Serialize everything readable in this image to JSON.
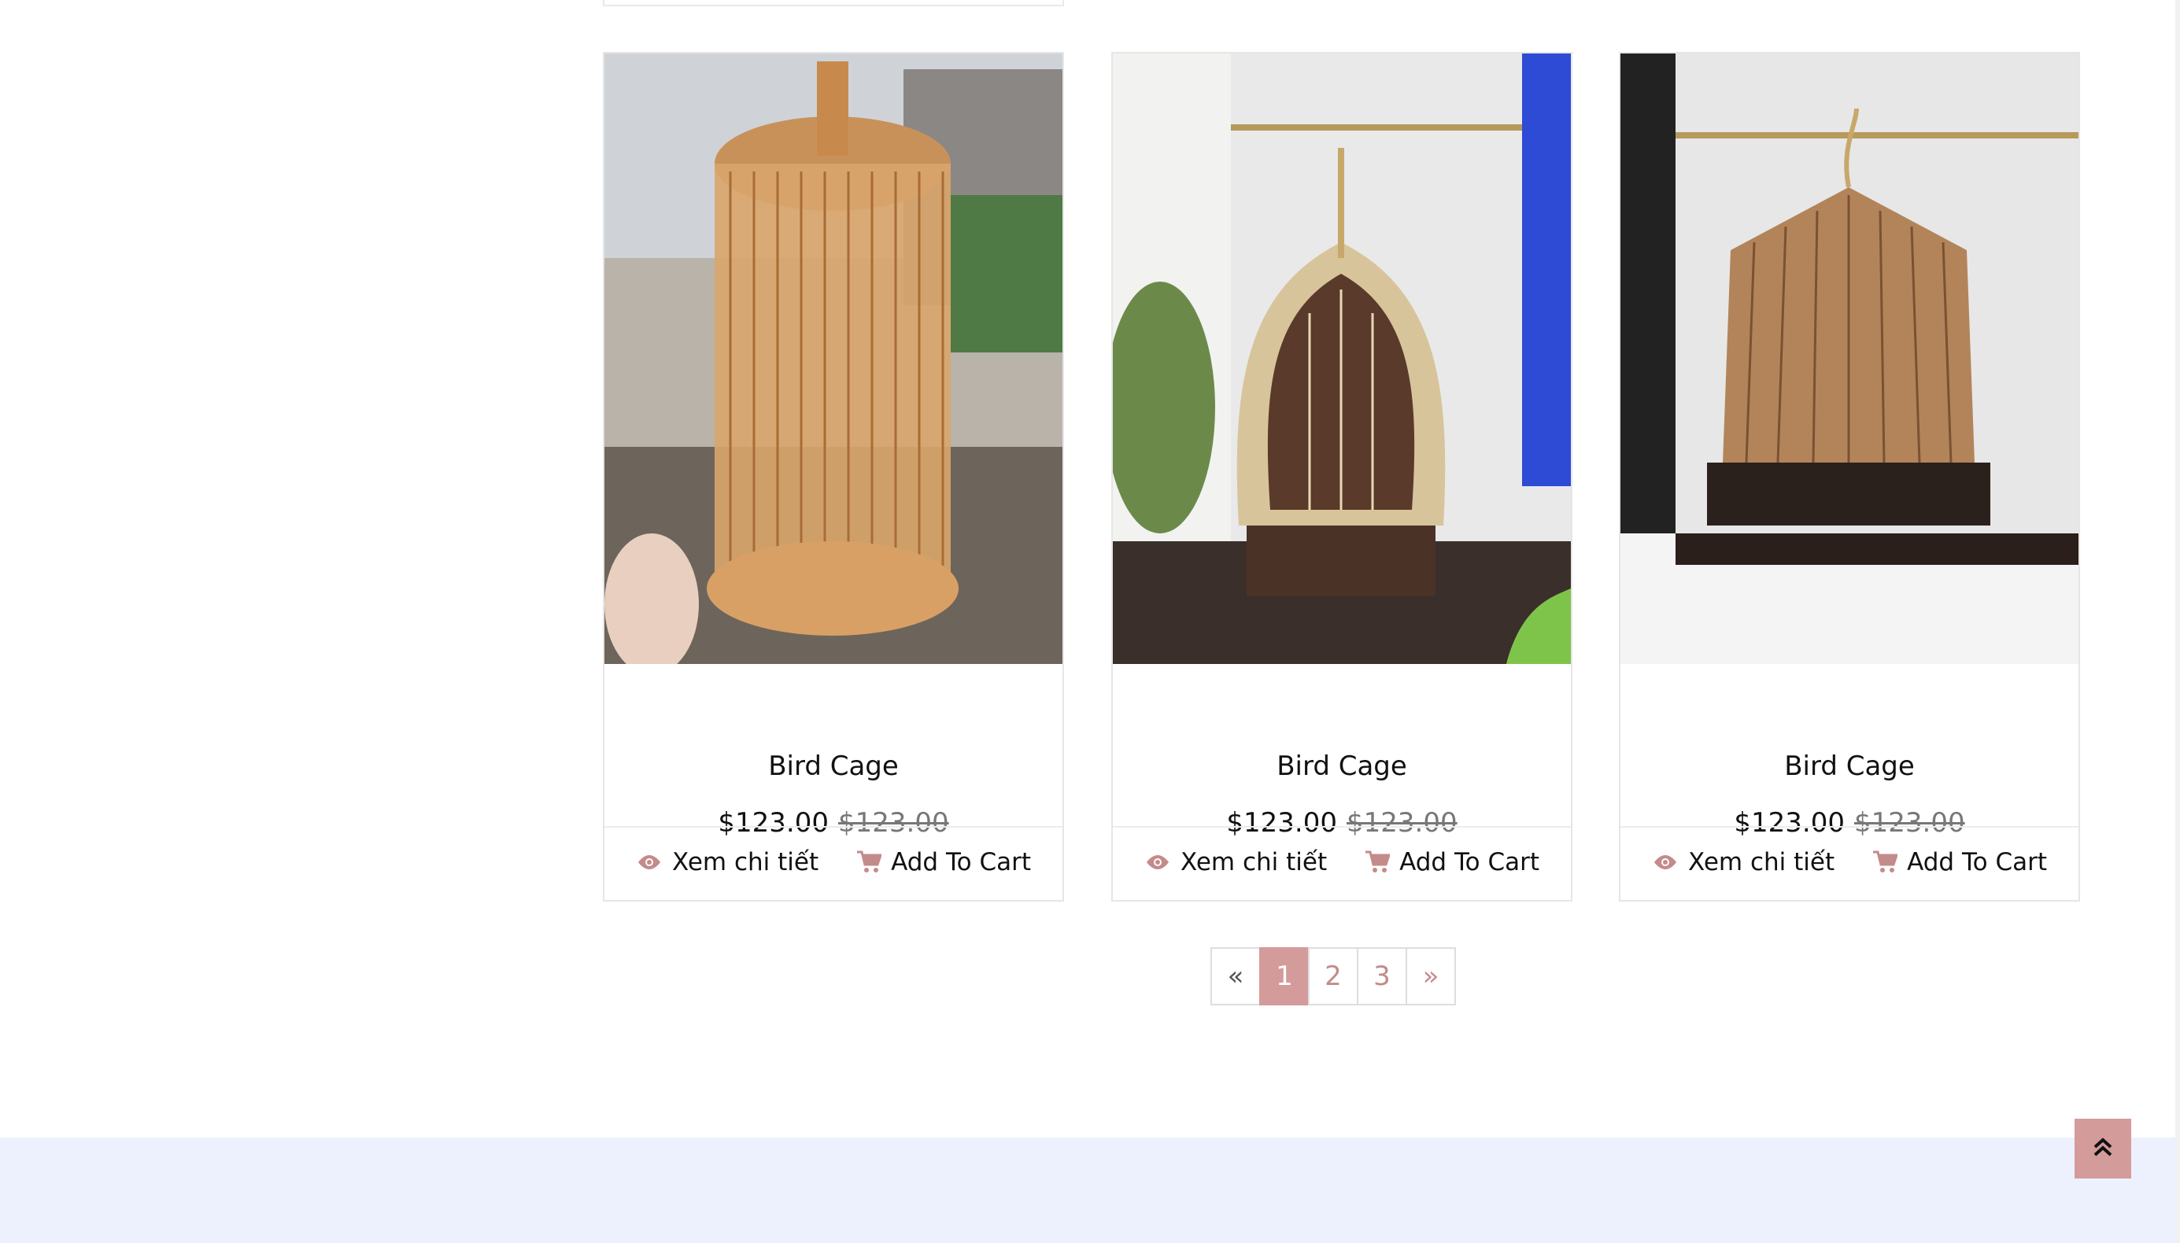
{
  "products": [
    {
      "title": "Bird Cage",
      "price": "$123.00",
      "old_price": "$123.00",
      "view_label": "Xem chi tiết",
      "cart_label": "Add To Cart"
    },
    {
      "title": "Bird Cage",
      "price": "$123.00",
      "old_price": "$123.00",
      "view_label": "Xem chi tiết",
      "cart_label": "Add To Cart"
    },
    {
      "title": "Bird Cage",
      "price": "$123.00",
      "old_price": "$123.00",
      "view_label": "Xem chi tiết",
      "cart_label": "Add To Cart"
    }
  ],
  "pagination": {
    "prev": "«",
    "pages": [
      "1",
      "2",
      "3"
    ],
    "next": "»",
    "active": "1"
  },
  "icons": {
    "view": "eye-icon",
    "cart": "shopping-cart-icon",
    "scroll_top": "double-chevron-up-icon"
  },
  "colors": {
    "accent": "#d49b9b",
    "footer_bg": "#edf1fd",
    "icon_muted": "#c48b8b"
  }
}
